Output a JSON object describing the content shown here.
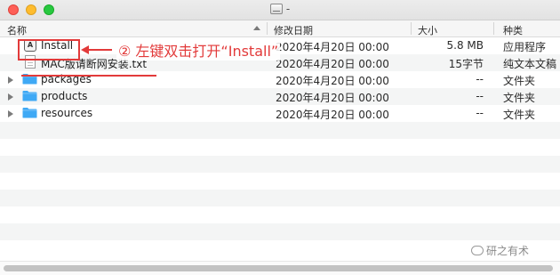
{
  "window": {
    "title": "-"
  },
  "columns": {
    "name": "名称",
    "date": "修改日期",
    "size": "大小",
    "kind": "种类"
  },
  "files": [
    {
      "name": "Install",
      "date": "2020年4月20日 00:00",
      "size": "5.8 MB",
      "kind": "应用程序",
      "icon": "app-icon",
      "expandable": false
    },
    {
      "name": "MAC版请断网安装.txt",
      "date": "2020年4月20日 00:00",
      "size": "15字节",
      "kind": "纯文本文稿",
      "icon": "text-file-icon",
      "expandable": false
    },
    {
      "name": "packages",
      "date": "2020年4月20日 00:00",
      "size": "--",
      "kind": "文件夹",
      "icon": "folder-icon",
      "expandable": true
    },
    {
      "name": "products",
      "date": "2020年4月20日 00:00",
      "size": "--",
      "kind": "文件夹",
      "icon": "folder-icon",
      "expandable": true
    },
    {
      "name": "resources",
      "date": "2020年4月20日 00:00",
      "size": "--",
      "kind": "文件夹",
      "icon": "folder-icon",
      "expandable": true
    }
  ],
  "annotation": {
    "text": "② 左键双击打开“Install”",
    "color": "#e23a3a"
  },
  "watermark": {
    "text": "研之有术"
  },
  "colors": {
    "folder": "#3fa9f5",
    "accent_red": "#e23a3a",
    "row_stripe": "#f4f5f5"
  }
}
